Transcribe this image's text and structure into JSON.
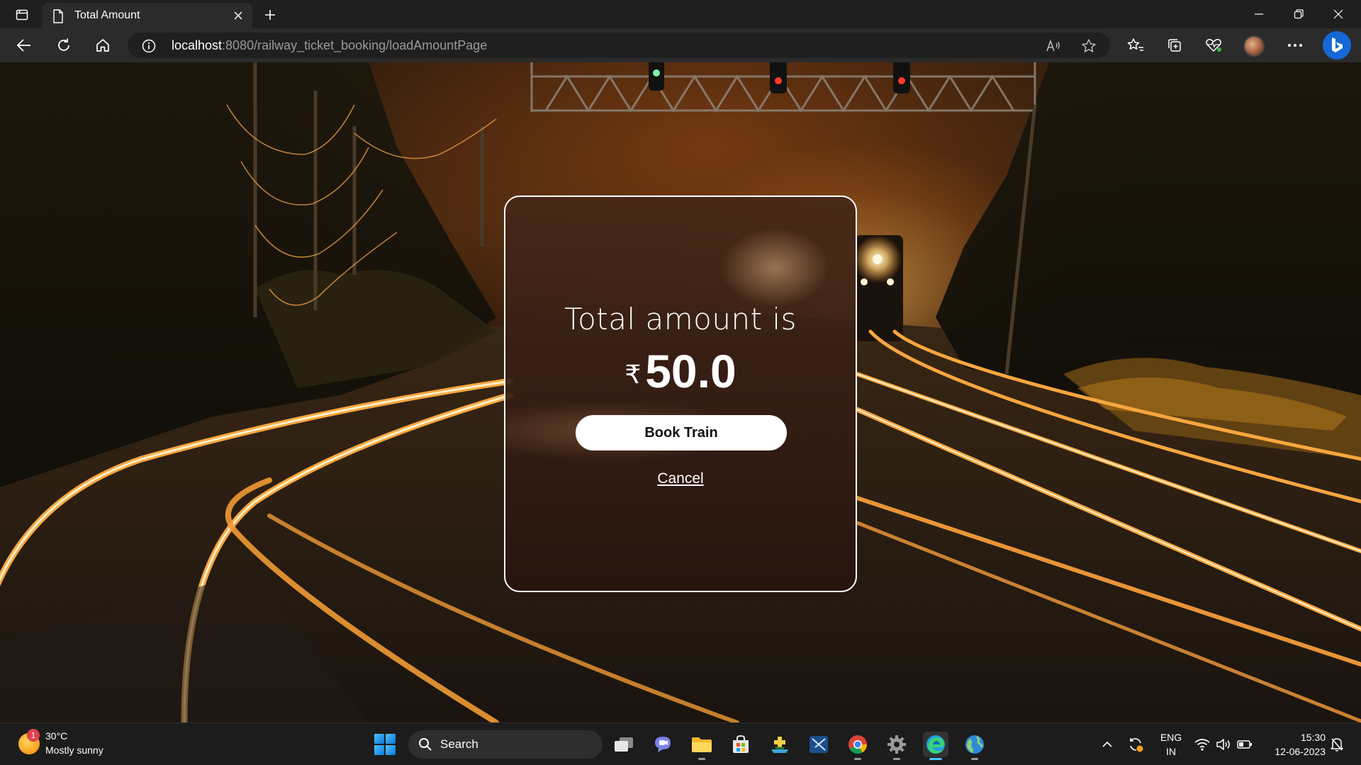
{
  "browser": {
    "tab_title": "Total Amount",
    "url_host": "localhost",
    "url_path": ":8080/railway_ticket_booking/loadAmountPage"
  },
  "card": {
    "heading": "Total amount is",
    "currency_symbol": "₹",
    "amount": "50.0",
    "book_button_label": "Book Train",
    "cancel_link_label": "Cancel"
  },
  "taskbar": {
    "weather_badge": "1",
    "weather_temp": "30°C",
    "weather_desc": "Mostly sunny",
    "search_label": "Search",
    "apps": [
      "task-view",
      "chat",
      "file-explorer",
      "microsoft-store",
      "app",
      "snipping-tool",
      "chrome",
      "settings",
      "edge",
      "maps"
    ],
    "lang_line1": "ENG",
    "lang_line2": "IN",
    "time": "15:30",
    "date": "12-06-2023"
  },
  "colors": {
    "accent": "#4cc2ff",
    "card_border": "#ffffff",
    "button_bg": "#ffffff",
    "rail_glow": "#f7a640"
  }
}
